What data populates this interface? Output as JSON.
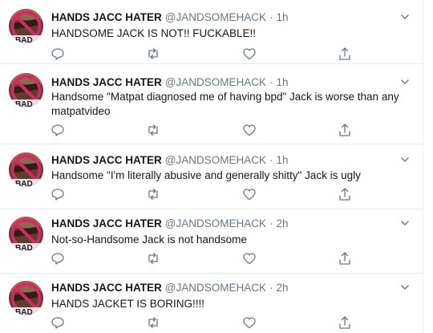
{
  "tweets": [
    {
      "name": "HANDS JACC HATER",
      "handle": "@JANDSOMEHACK",
      "separator": "·",
      "time": "1h",
      "lines": [
        "HANDSOME JACK IS NOT!! FUCKABLE!!"
      ]
    },
    {
      "name": "HANDS JACC HATER",
      "handle": "@JANDSOMEHACK",
      "separator": "·",
      "time": "1h",
      "lines": [
        "Handsome \"Matpat diagnosed me of having bpd\" Jack is worse than any",
        "matpatvideo"
      ]
    },
    {
      "name": "HANDS JACC HATER",
      "handle": "@JANDSOMEHACK",
      "separator": "·",
      "time": "1h",
      "lines": [
        "Handsome \"I'm literally abusive and generally shitty\" Jack is ugly"
      ]
    },
    {
      "name": "HANDS JACC HATER",
      "handle": "@JANDSOMEHACK",
      "separator": "·",
      "time": "2h",
      "lines": [
        "Not-so-Handsome Jack is not handsome"
      ]
    },
    {
      "name": "HANDS JACC HATER",
      "handle": "@JANDSOMEHACK",
      "separator": "·",
      "time": "2h",
      "lines": [
        "HANDS JACKET IS BORING!!!!"
      ]
    }
  ],
  "avatar_badge_text": "BAD",
  "icons": {
    "more": "chevron-down-icon",
    "reply": "reply-icon",
    "retweet": "retweet-icon",
    "like": "heart-icon",
    "share": "share-icon"
  },
  "colors": {
    "name": "#14171a",
    "muted": "#657786",
    "divider": "#e6ecf0",
    "badge_red": "#e0245e"
  }
}
